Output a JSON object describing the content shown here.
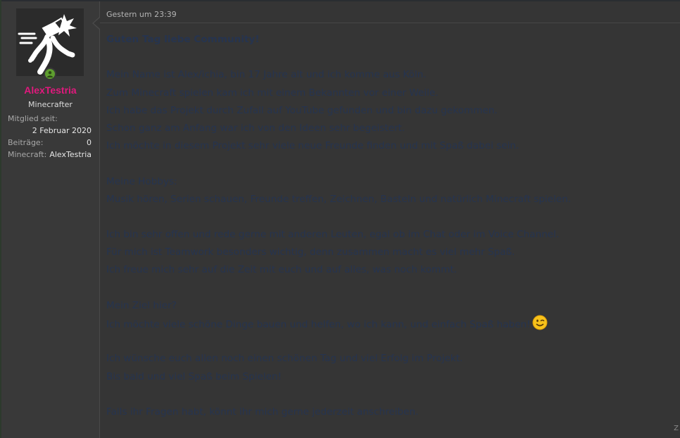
{
  "post": {
    "timestamp": "Gestern um 23:39",
    "body": {
      "title": "Guten Tag liebe Community!",
      "lines": [
        "",
        "Mein Name ist Alex/ichia, bin 17 Jahre alt und ich komme aus Köln.",
        "Zum Minecraft spielen kam ich mit einem Bekannten vor einer Weile.",
        "Ich habe das Projekt durch Zufall auf YouTube gefunden und bin dazu gekommen.",
        "Schon ganz am Anfang war ich von den Ideen sehr begeistert.",
        "Ich möchte in diesem Projekt sehr viele neue Freunde finden und mit Spaß dabei sein.",
        "",
        "Meine Hobbys:",
        "Musik hören, Serien schauen, Freunde treffen, Zeichnen, Basteln und natürlich Minecraft spielen.",
        "",
        "Ich bin sehr offen und rede gerne mit anderen Leuten, egal ob im Chat oder im Voice Channel.",
        "Für mich ist Teamwork besonders wichtig, denn zusammen macht es viel mehr Spaß.",
        "Ich freue mich sehr auf die Zeit mit euch und auf alles, was noch kommt.",
        "",
        "Mein Ziel hier?",
        "Ich möchte viele schöne Dinge bauen und helfen, wo ich kann, und einfach Spaß haben!",
        "",
        "Ich wünsche euch allen noch einen schönen Tag und viel Erfolg im Projekt.",
        "Bis bald und viel Spaß beim Spielen!",
        "",
        "Falls ihr Fragen habt, könnt ihr mich gerne jederzeit anschreiben."
      ],
      "wink_after_line": 15
    },
    "corner_glyph": "Z"
  },
  "user": {
    "name": "AlexTestria",
    "title": "Minecrafter",
    "fields": [
      {
        "label": "Mitglied seit:",
        "value": ""
      },
      {
        "label": "",
        "value": "2 Februar 2020"
      },
      {
        "label": "Beiträge:",
        "value": "0"
      },
      {
        "label": "Minecraft:",
        "value": "AlexTestria"
      }
    ],
    "status": "online"
  },
  "colors": {
    "username": "#e0197d",
    "online": "#5e9e2f",
    "body_text": "#26344f",
    "background": "#353535",
    "sidebar": "#393939"
  },
  "icons": {
    "avatar": "avatar-sword-icon",
    "online": "user-online-icon",
    "emoji": "wink-emoji-icon"
  }
}
